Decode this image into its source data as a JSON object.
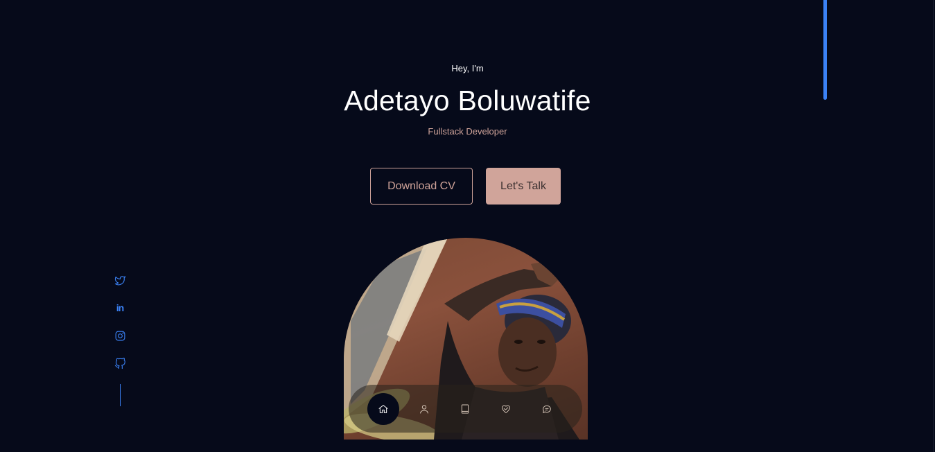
{
  "hero": {
    "greeting": "Hey, I'm",
    "name": "Adetayo Boluwatife",
    "role": "Fullstack Developer"
  },
  "buttons": {
    "download_cv": "Download CV",
    "lets_talk": "Let's Talk"
  },
  "socials": [
    {
      "name": "twitter",
      "icon": "twitter-icon"
    },
    {
      "name": "linkedin",
      "icon": "linkedin-icon",
      "glyph": "in"
    },
    {
      "name": "instagram",
      "icon": "instagram-icon"
    },
    {
      "name": "github",
      "icon": "github-icon"
    }
  ],
  "nav": {
    "items": [
      {
        "icon": "home-icon",
        "active": true
      },
      {
        "icon": "user-icon",
        "active": false
      },
      {
        "icon": "book-icon",
        "active": false
      },
      {
        "icon": "heart-icon",
        "active": false
      },
      {
        "icon": "chat-icon",
        "active": false
      }
    ]
  },
  "colors": {
    "background": "#060a1a",
    "accent": "#d0a49a",
    "social": "#3b82f6",
    "text": "#ffffff"
  }
}
